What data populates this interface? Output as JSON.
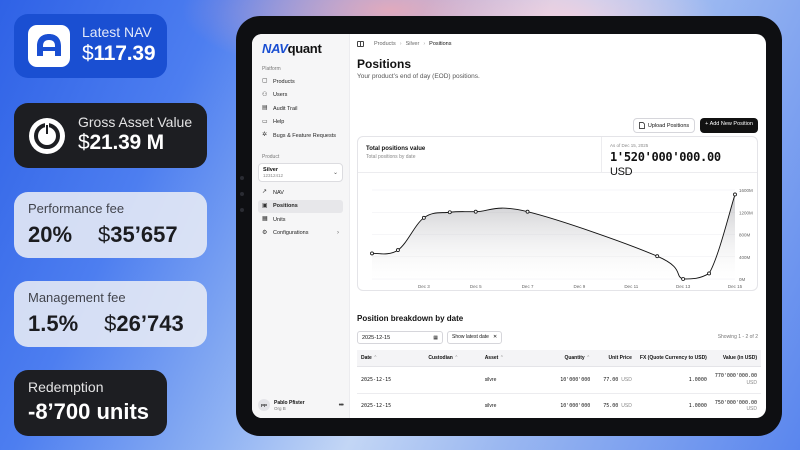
{
  "cards": {
    "latest_nav": {
      "label": "Latest NAV",
      "currency": "$",
      "value": "117.39"
    },
    "gross_asset_value": {
      "label": "Gross Asset Value",
      "currency": "$",
      "value": "21.39 M"
    },
    "performance_fee": {
      "label": "Performance fee",
      "percent": "20%",
      "currency": "$",
      "amount": "35’657"
    },
    "management_fee": {
      "label": "Management fee",
      "percent": "1.5%",
      "currency": "$",
      "amount": "26’743"
    },
    "redemption": {
      "label": "Redemption",
      "value": "-8’700 units"
    }
  },
  "app": {
    "brand_prefix": "NAV",
    "brand_suffix": "quant",
    "breadcrumb": [
      "Products",
      "Silver",
      "Positions"
    ],
    "sidebar": {
      "platform_label": "Platform",
      "platform_items": [
        {
          "label": "Products",
          "icon": "box-icon"
        },
        {
          "label": "Users",
          "icon": "users-icon"
        },
        {
          "label": "Audit Trail",
          "icon": "file-icon"
        },
        {
          "label": "Help",
          "icon": "book-icon"
        },
        {
          "label": "Bugs & Feature Requests",
          "icon": "bug-icon"
        }
      ],
      "product_label": "Product",
      "product_select": {
        "name": "Silver",
        "code": "12312412"
      },
      "product_items": [
        {
          "label": "NAV",
          "icon": "chart-icon"
        },
        {
          "label": "Positions",
          "icon": "briefcase-icon",
          "active": true
        },
        {
          "label": "Units",
          "icon": "grid-icon"
        },
        {
          "label": "Configurations",
          "icon": "settings-icon"
        }
      ],
      "user": {
        "initials": "PP",
        "name": "Pablo Pfister",
        "org": "Org B"
      }
    },
    "page": {
      "title": "Positions",
      "subtitle": "Your product’s end of day (EOD) positions.",
      "upload_label": "Upload Positions",
      "add_label": "+ Add New Position"
    },
    "chart_card": {
      "title": "Total positions value",
      "subtitle": "Total positions by date",
      "as_of": "As of Dec 15, 2025",
      "total": "1'520'000'000.00",
      "total_currency": "USD"
    },
    "breakdown": {
      "title": "Position breakdown by date",
      "date_value": "2025-12-15",
      "chip_label": "Show latest date",
      "showing": "Showing 1 - 2 of 2",
      "columns": [
        "Date",
        "Custodian",
        "Asset",
        "Quantity",
        "Unit Price",
        "FX (Quote Currency to USD)",
        "Value (in USD)"
      ],
      "rows": [
        {
          "date": "2025-12-15",
          "custodian": "",
          "asset": "silvre",
          "quantity": "10'000'000",
          "unit_price": "77.00",
          "unit_ccy": "USD",
          "fx": "1.0000",
          "value": "770'000'000.00",
          "value_ccy": "USD"
        },
        {
          "date": "2025-12-15",
          "custodian": "",
          "asset": "silvre",
          "quantity": "10'000'000",
          "unit_price": "75.00",
          "unit_ccy": "USD",
          "fx": "1.0000",
          "value": "750'000'000.00",
          "value_ccy": "USD"
        }
      ]
    }
  },
  "chart_data": {
    "type": "area",
    "title": "Total positions value",
    "subtitle": "Total positions by date",
    "x": [
      "Dec 1",
      "Dec 2",
      "Dec 3",
      "Dec 4",
      "Dec 5",
      "Dec 7",
      "Dec 12",
      "Dec 13",
      "Dec 14",
      "Dec 15"
    ],
    "y": [
      460,
      520,
      1100,
      1200,
      1210,
      1210,
      410,
      0,
      100,
      1520
    ],
    "x_ticks": [
      "Dec 3",
      "Dec 5",
      "Dec 7",
      "Dec 9",
      "Dec 11",
      "Dec 13",
      "Dec 15"
    ],
    "y_ticks": [
      "0M",
      "400M",
      "800M",
      "1200M",
      "1600M"
    ],
    "ylim": [
      0,
      1600
    ],
    "y_unit": "M",
    "grid": true,
    "color": "#111111"
  }
}
